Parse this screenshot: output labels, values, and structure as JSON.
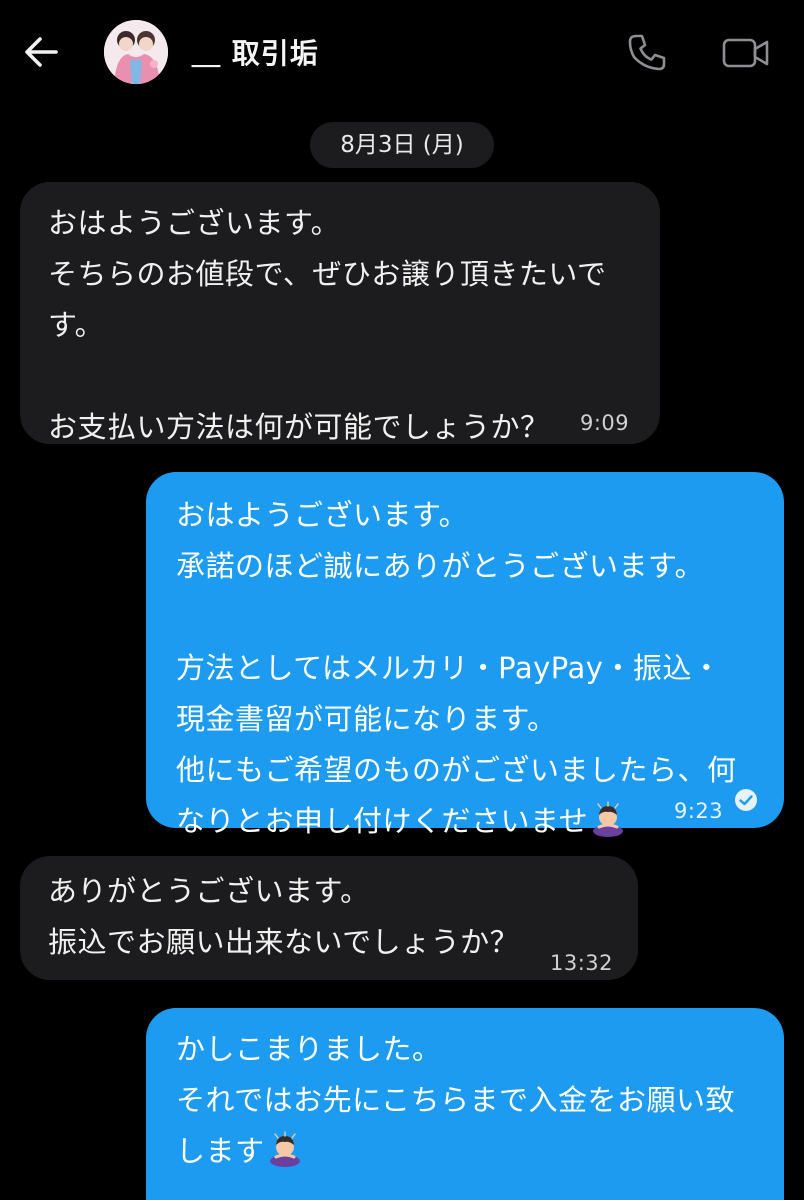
{
  "header": {
    "contact_name": "＿ 取引垢",
    "icons": {
      "back": "back-arrow-icon",
      "call": "phone-icon",
      "video": "video-camera-icon"
    }
  },
  "date_separator": "8月3日 (月)",
  "messages": [
    {
      "side": "incoming",
      "text": "おはようございます。\nそちらのお値段で、ぜひお譲り頂きたいで\nす。\n\nお支払い方法は何が可能でしょうか？",
      "time": "9:09"
    },
    {
      "side": "outgoing",
      "text": "おはようございます。\n承諾のほど誠にありがとうございます。\n\n方法としてはメルカリ・PayPay・振込・\n現金書留が可能になります。\n他にもご希望のものがございましたら、何\nなりとお申し付けくださいませ",
      "emoji": "person-bowing-emoji",
      "time": "9:23",
      "read": true
    },
    {
      "side": "incoming",
      "text": "ありがとうございます。\n振込でお願い出来ないでしょうか？",
      "time": "13:32"
    },
    {
      "side": "outgoing",
      "text": "かしこまりました。\nそれではお先にこちらまで入金をお願い致\nします",
      "emoji": "person-bowing-emoji"
    }
  ],
  "colors": {
    "background": "#000000",
    "incoming_bubble": "#1c1c1e",
    "outgoing_bubble": "#1d9bf0",
    "date_pill": "#1c1c1e"
  }
}
